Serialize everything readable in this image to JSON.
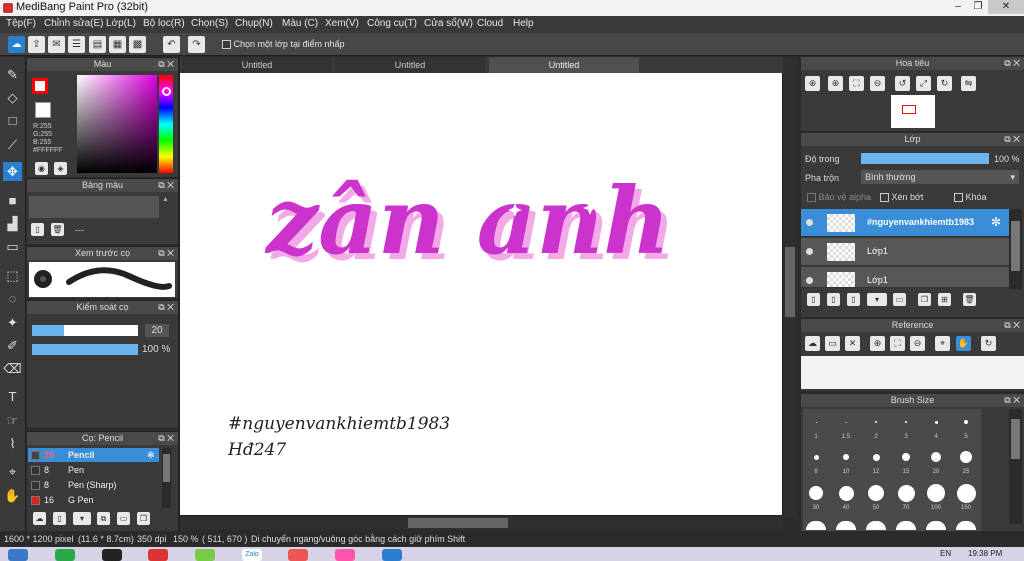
{
  "app": {
    "title": "MediBang Paint Pro (32bit)",
    "window_buttons": [
      "–",
      "❐",
      "✕"
    ]
  },
  "menu": [
    "Tệp(F)",
    "Chỉnh sửa(E)",
    "Lớp(L)",
    "Bộ lọc(R)",
    "Chọn(S)",
    "Chụp(N)",
    "Màu (C)",
    "Xem(V)",
    "Công cụ(T)",
    "Cửa sổ(W)",
    "Cloud",
    "Help"
  ],
  "toolbar": {
    "option_label": "Chọn một lớp tại điểm nhấp"
  },
  "color_panel": {
    "title": "Màu",
    "r": "R:255",
    "g": "G:255",
    "b": "B:255",
    "hex": "#FFFFFF",
    "primary_color": "#ff0000",
    "secondary_color": "#ffffff"
  },
  "palette_panel": {
    "title": "Bảng màu",
    "value": "---"
  },
  "brush_preview_panel": {
    "title": "Xem trước cọ"
  },
  "brush_control_panel": {
    "title": "Kiểm soát cọ",
    "size": "20",
    "opacity": "100 %",
    "size_fill": 0.3,
    "opacity_fill": 1.0
  },
  "brush_list_panel": {
    "title": "Cọ: Pencil",
    "items": [
      {
        "size": "20",
        "name": "Pencil",
        "color": "#444444",
        "selected": true
      },
      {
        "size": "8",
        "name": "Pen",
        "color": "#333333"
      },
      {
        "size": "8",
        "name": "Pen (Sharp)",
        "color": "#333333"
      },
      {
        "size": "16",
        "name": "G Pen",
        "color": "#dd2222"
      }
    ]
  },
  "tabs": [
    "Untitled",
    "Untitled",
    "Untitled"
  ],
  "canvas": {
    "main_text": "zân anh",
    "hashtag": "#nguyenvankhiemtb1983",
    "code": "Hđ247",
    "art_color": "#cc33cc"
  },
  "navigator_panel": {
    "title": "Hoa tiêu"
  },
  "layer_panel": {
    "title": "Lớp",
    "opacity_label": "Độ trong",
    "opacity_value": "100 %",
    "opacity_fill": 1.0,
    "blend_label": "Pha trộn",
    "blend_value": "Bình thường",
    "alpha_protect": "Bảo vệ alpha",
    "clipping": "Xén bớt",
    "lock": "Khóa",
    "layers": [
      {
        "name": "#nguyenvankhiemtb1983",
        "selected": true
      },
      {
        "name": "Lớp1",
        "selected": false
      },
      {
        "name": "Lớp1",
        "selected": false
      }
    ]
  },
  "reference_panel": {
    "title": "Reference"
  },
  "brush_size_panel": {
    "title": "Brush Size",
    "row1": [
      "1",
      "1.5",
      "2",
      "3",
      "4",
      "5"
    ],
    "row2": [
      "8",
      "10",
      "12",
      "15",
      "20",
      "25"
    ],
    "row3": [
      "30",
      "40",
      "50",
      "70",
      "100",
      "150"
    ]
  },
  "status": {
    "dims": "1600 * 1200 pixel",
    "phys": "(11.6 * 8.7cm)",
    "dpi": "350 dpi",
    "zoom": "150 %",
    "coords": "( 511, 670 )",
    "hint": "Di chuyển ngang/vuông góc bằng cách giữ phím Shift"
  },
  "taskbar": {
    "lang": "EN",
    "time": "19:38 PM",
    "zalo": "Zalo"
  }
}
